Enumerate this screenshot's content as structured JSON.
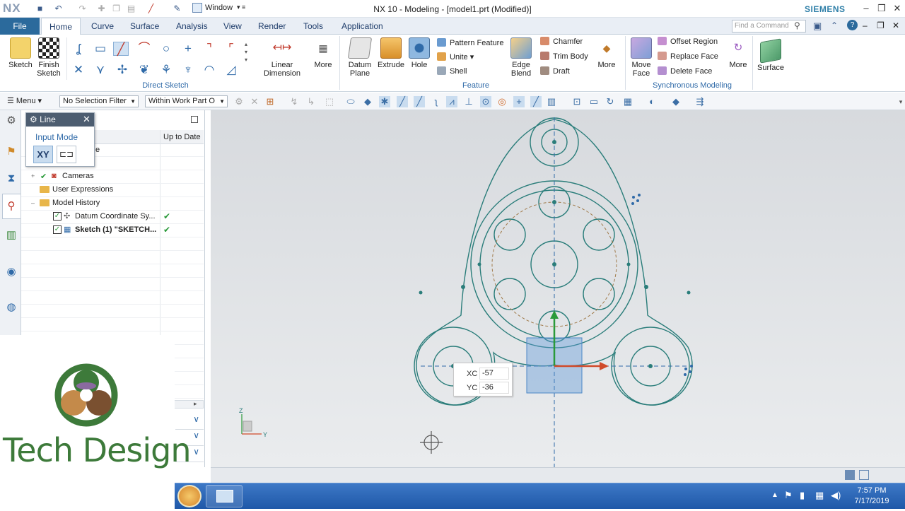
{
  "titlebar": {
    "logo": "NX",
    "window_menu": "Window",
    "title": "NX 10 - Modeling - [model1.prt (Modified)]",
    "brand": "SIEMENS"
  },
  "tabs": [
    "File",
    "Home",
    "Curve",
    "Surface",
    "Analysis",
    "View",
    "Render",
    "Tools",
    "Application"
  ],
  "find_command": {
    "placeholder": "Find a Command"
  },
  "ribbon": {
    "sketch": "Sketch",
    "finish_sketch": "Finish Sketch",
    "direct_sketch_group": "Direct Sketch",
    "linear_dimension": "Linear Dimension",
    "more1": "More",
    "datum_plane": "Datum Plane",
    "extrude": "Extrude",
    "hole": "Hole",
    "pattern_feature": "Pattern Feature",
    "unite": "Unite",
    "shell": "Shell",
    "edge_blend": "Edge Blend",
    "chamfer": "Chamfer",
    "trim_body": "Trim Body",
    "draft": "Draft",
    "more2": "More",
    "feature_group": "Feature",
    "move_face": "Move Face",
    "offset_region": "Offset Region",
    "replace_face": "Replace Face",
    "delete_face": "Delete Face",
    "more3": "More",
    "surface": "Surface",
    "sync_group": "Synchronous Modeling"
  },
  "toolbar2": {
    "menu": "Menu",
    "selection_filter": "No Selection Filter",
    "scope": "Within Work Part O"
  },
  "line_popup": {
    "title": "Line",
    "input_mode": "Input Mode",
    "xy": "XY"
  },
  "navigator": {
    "col_uptodate": "Up to Date",
    "row_name_fragment": "e",
    "items": [
      {
        "label": "Cameras"
      },
      {
        "label": "User Expressions"
      },
      {
        "label": "Model History"
      },
      {
        "label": "Datum Coordinate Sy..."
      },
      {
        "label": "Sketch (1) \"SKETCH..."
      }
    ]
  },
  "coord_input": {
    "xc_label": "XC",
    "xc_value": "-57",
    "yc_label": "YC",
    "yc_value": "-36"
  },
  "axis": {
    "z": "Z",
    "y": "Y"
  },
  "watermark": {
    "text": "Tech Design"
  },
  "taskbar": {
    "time": "7:57 PM",
    "date": "7/17/2019"
  },
  "colors": {
    "sketch": "#2a7d7a",
    "accent": "#2b6a9c",
    "brand": "#2f7fa8",
    "watermark": "#3d7a3a"
  }
}
